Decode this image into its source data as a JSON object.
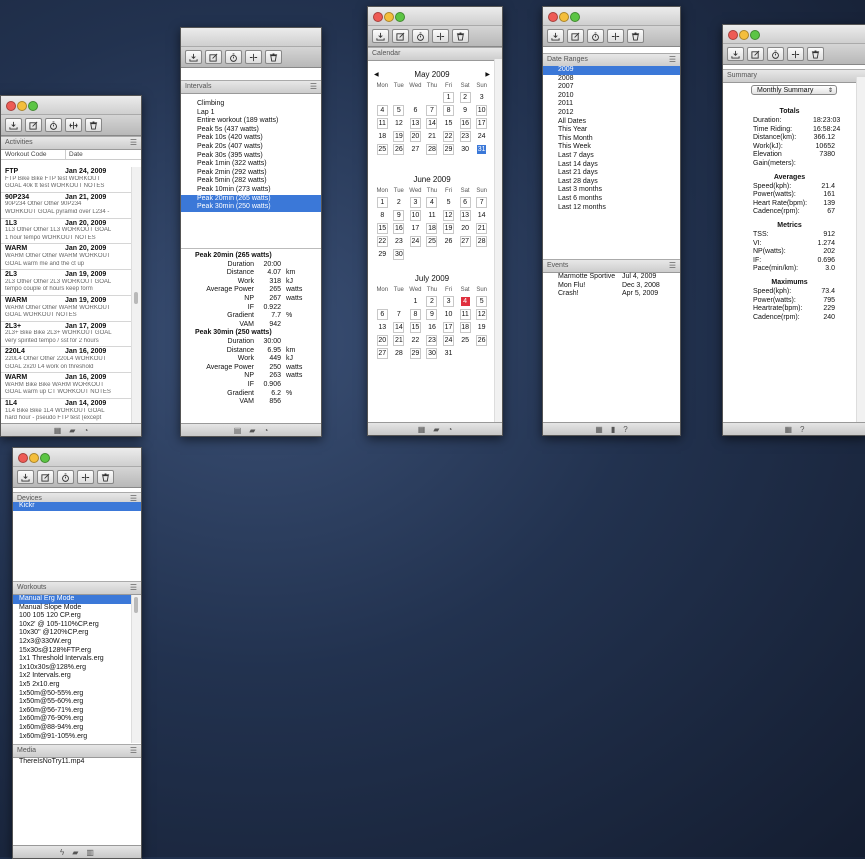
{
  "activities": {
    "header": "Activities",
    "col_code": "Workout Code",
    "col_date": "Date",
    "rows": [
      {
        "code": "FTP",
        "date": "Jan 24, 2009",
        "l1": "FTP Bike Bike FTP test WORKOUT",
        "l2": "GOAL 40k tt test  WORKOUT NOTES"
      },
      {
        "code": "90P234",
        "date": "Jan 21, 2009",
        "l1": "90P234 Other Other 90P234",
        "l2": "WORKOUT GOAL pyramid over L234 -"
      },
      {
        "code": "1L3",
        "date": "Jan 20, 2009",
        "l1": "1L3 Other Other 1L3 WORKOUT GOAL",
        "l2": "1 hour tempo WORKOUT NOTES"
      },
      {
        "code": "WARM",
        "date": "Jan 20, 2009",
        "l1": "WARM Other Other WARM WORKOUT",
        "l2": "GOAL warm me and the ct up"
      },
      {
        "code": "2L3",
        "date": "Jan 19, 2009",
        "l1": "2L3 Other Other 2L3 WORKOUT GOAL",
        "l2": "tempo couple of hours keep form"
      },
      {
        "code": "WARM",
        "date": "Jan 19, 2009",
        "l1": "WARM Other Other WARM WORKOUT",
        "l2": "GOAL  WORKOUT NOTES"
      },
      {
        "code": "2L3+",
        "date": "Jan 17, 2009",
        "l1": "2L3+ Bike Bike 2L3+ WORKOUT GOAL",
        "l2": "very spirited tempo / sst for 2 hours"
      },
      {
        "code": "220L4",
        "date": "Jan 16, 2009",
        "l1": "220L4 Other Other 220L4 WORKOUT",
        "l2": "GOAL 2x20 L4 work on threshold"
      },
      {
        "code": "WARM",
        "date": "Jan 16, 2009",
        "l1": "WARM Bike Bike WARM WORKOUT",
        "l2": "GOAL warm up CT WORKOUT NOTES"
      },
      {
        "code": "1L4",
        "date": "Jan 14, 2009",
        "l1": "1L4 Bike Bike 1L4 WORKOUT GOAL",
        "l2": "hard hour - pseudo FTP test (except"
      },
      {
        "code": "2x20L4",
        "date": "Jan 13, 2009",
        "l1": "2x20L4 Other Other 2x20L4",
        "l2": "WORKOUT GOAL threshold intervals 2"
      }
    ]
  },
  "intervals": {
    "header": "Intervals",
    "items": [
      "Climbing",
      "Lap 1",
      "Entire workout (189 watts)",
      "Peak 5s (437 watts)",
      "Peak 10s (420 watts)",
      "Peak 20s (407 watts)",
      "Peak 30s (395 watts)",
      "Peak 1min (322 watts)",
      "Peak 2min (292 watts)",
      "Peak 5min (282 watts)",
      "Peak 10min (273 watts)",
      "Peak 20min (265 watts)",
      "Peak 30min (250 watts)"
    ],
    "details": [
      {
        "title": "Peak 20min (265 watts)",
        "rows": [
          [
            "Duration",
            "20:00",
            ""
          ],
          [
            "Distance",
            "4.07",
            "km"
          ],
          [
            "Work",
            "318",
            "kJ"
          ],
          [
            "Average Power",
            "265",
            "watts"
          ],
          [
            "NP",
            "267",
            "watts"
          ],
          [
            "IF",
            "0.922",
            ""
          ],
          [
            "Gradient",
            "7.7",
            "%"
          ],
          [
            "VAM",
            "942",
            ""
          ]
        ]
      },
      {
        "title": "Peak 30min (250 watts)",
        "rows": [
          [
            "Duration",
            "30:00",
            ""
          ],
          [
            "Distance",
            "6.95",
            "km"
          ],
          [
            "Work",
            "449",
            "kJ"
          ],
          [
            "Average Power",
            "250",
            "watts"
          ],
          [
            "NP",
            "263",
            "watts"
          ],
          [
            "IF",
            "0.906",
            ""
          ],
          [
            "Gradient",
            "6.2",
            "%"
          ],
          [
            "VAM",
            "856",
            ""
          ]
        ]
      }
    ]
  },
  "calendar": {
    "header": "Calendar",
    "dow": [
      "Mon",
      "Tue",
      "Wed",
      "Thu",
      "Fri",
      "Sat",
      "Sun"
    ],
    "months": [
      {
        "title": "May 2009",
        "offset": 4,
        "days": 31,
        "selected": 31,
        "accent": "#3b78d8"
      },
      {
        "title": "June 2009",
        "offset": 0,
        "days": 30,
        "selected": 0,
        "accent": ""
      },
      {
        "title": "July 2009",
        "offset": 2,
        "days": 31,
        "selected": 4,
        "accent": "#e0303e"
      }
    ],
    "prev_icon": "◀",
    "next_icon": "▶"
  },
  "date_ranges": {
    "header": "Date Ranges",
    "items": [
      "2009",
      "2008",
      "2007",
      "2010",
      "2011",
      "2012",
      "All Dates",
      "This Year",
      "This Month",
      "This Week",
      "Last 7 days",
      "Last 14 days",
      "Last 21 days",
      "Last 28 days",
      "Last 3 months",
      "Last 6 months",
      "Last 12 months"
    ]
  },
  "events": {
    "header": "Events",
    "items": [
      {
        "name": "Marmotte Sportive",
        "date": "Jul 4, 2009"
      },
      {
        "name": "Mon Flu!",
        "date": "Dec 3, 2008"
      },
      {
        "name": "Crash!",
        "date": "Apr 5, 2009"
      }
    ]
  },
  "summary": {
    "header": "Summary",
    "selector": "Monthly Summary",
    "sections": [
      {
        "title": "Totals",
        "rows": [
          [
            "Duration:",
            "18:23:03"
          ],
          [
            "Time Riding:",
            "16:58:24"
          ],
          [
            "Distance(km):",
            "366.12"
          ],
          [
            "Work(kJ):",
            "10652"
          ],
          [
            "Elevation Gain(meters):",
            "7380"
          ]
        ]
      },
      {
        "title": "Averages",
        "rows": [
          [
            "Speed(kph):",
            "21.4"
          ],
          [
            "Power(watts):",
            "161"
          ],
          [
            "Heart Rate(bpm):",
            "139"
          ],
          [
            "Cadence(rpm):",
            "67"
          ]
        ]
      },
      {
        "title": "Metrics",
        "rows": [
          [
            "TSS:",
            "912"
          ],
          [
            "VI:",
            "1.274"
          ],
          [
            "NP(watts):",
            "202"
          ],
          [
            "IF:",
            "0.696"
          ],
          [
            "Pace(min/km):",
            "3.0"
          ]
        ]
      },
      {
        "title": "Maximums",
        "rows": [
          [
            "Speed(kph):",
            "73.4"
          ],
          [
            "Power(watts):",
            "795"
          ],
          [
            "Heartrate(bpm):",
            "229"
          ],
          [
            "Cadence(rpm):",
            "240"
          ]
        ]
      }
    ]
  },
  "train": {
    "devices_header": "Devices",
    "devices": [
      "Kickr"
    ],
    "workouts_header": "Workouts",
    "workouts": [
      "Manual Erg Mode",
      "Manual Slope Mode",
      "100 105 120 CP.erg",
      "10x2' @ 105-110%CP.erg",
      "10x30\" @120%CP.erg",
      "12x3@330W.erg",
      "15x30s@128%FTP.erg",
      "1x1 Threshold Intervals.erg",
      "1x10x30s@128%.erg",
      "1x2 Intervals.erg",
      "1x5 2x10.erg",
      "1x50m@50-55%.erg",
      "1x50m@55-60%.erg",
      "1x60m@56-71%.erg",
      "1x60m@76-90%.erg",
      "1x60m@88-94%.erg",
      "1x60m@91-105%.erg"
    ],
    "media_header": "Media",
    "media": [
      "ThereIsNoTry11.mp4"
    ]
  }
}
